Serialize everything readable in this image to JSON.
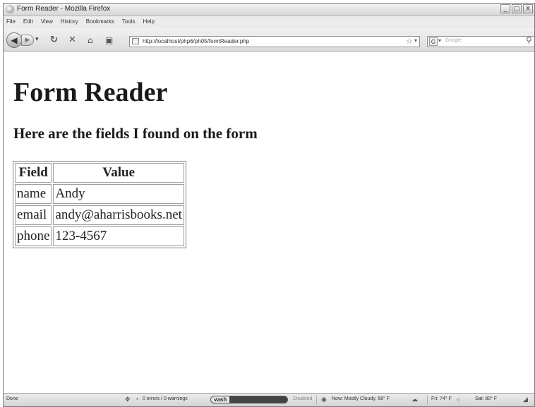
{
  "window": {
    "title": "Form Reader - Mozilla Firefox",
    "controls": [
      "_",
      "□",
      "X"
    ]
  },
  "menubar": {
    "items": [
      "File",
      "Edit",
      "View",
      "History",
      "Bookmarks",
      "Tools",
      "Help"
    ]
  },
  "toolbar": {
    "history_dropdown": "▾",
    "url": "http://localhost/php6/ph05/formReader.php",
    "url_dropdown": "▾",
    "search_engine": "G",
    "search_dropdown": "▾",
    "search_placeholder": "Google",
    "icons": [
      "back-icon",
      "forward-icon",
      "reload-icon",
      "stop-icon",
      "home-icon",
      "screenshot-icon",
      "page-icon",
      "bookmark-star-icon",
      "search-icon"
    ]
  },
  "page": {
    "heading": "Form Reader",
    "subheading": "Here are the fields I found on the form",
    "table": {
      "headers": [
        "Field",
        "Value"
      ],
      "rows": [
        [
          "name",
          "Andy"
        ],
        [
          "email",
          "andy@aharrisbooks.net"
        ],
        [
          "phone",
          "123-4567"
        ]
      ]
    }
  },
  "statusbar": {
    "status": "Done",
    "errors": "0 errors / 0 warnings",
    "vash": "vash",
    "disabled": "Disabled",
    "weather_now": "Now: Mostly Cloudy, 68° F",
    "forecast_fri": "Fri: 74° F",
    "forecast_sat": "Sat: 80° F"
  }
}
